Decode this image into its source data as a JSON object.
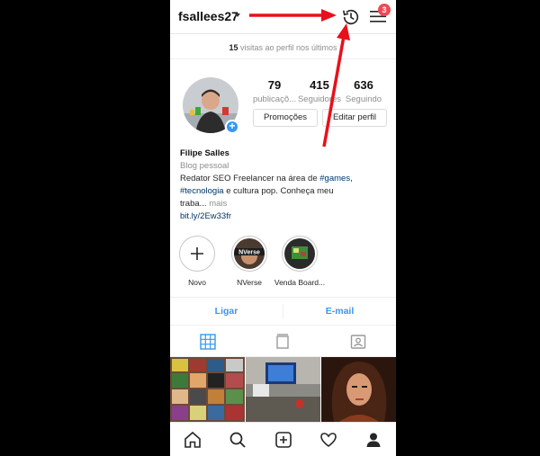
{
  "header": {
    "username": "fsallees27",
    "notif_count": "3"
  },
  "visits": {
    "count": "15",
    "text": " visitas ao perfil nos últimos"
  },
  "stats": [
    {
      "num": "79",
      "label": "publicaçõ..."
    },
    {
      "num": "415",
      "label": "Seguidores"
    },
    {
      "num": "636",
      "label": "Seguindo"
    }
  ],
  "buttons": {
    "promo": "Promoções",
    "edit": "Editar perfil"
  },
  "bio": {
    "name": "Filipe Salles",
    "category": "Blog pessoal",
    "line1": "Redator SEO Freelancer na área de ",
    "tag_games": "#games",
    "line1_end": ",",
    "tag_tec": "#tecnologia",
    "line2": " e cultura pop. Conheça meu",
    "line3": "traba...",
    "more": " mais",
    "link": "bit.ly/2Ew33fr"
  },
  "highlights": [
    {
      "label": "Novo"
    },
    {
      "label": "NVerse",
      "cover_text": "NVerse"
    },
    {
      "label": "Venda Board..."
    }
  ],
  "contact": {
    "call": "Ligar",
    "email": "E-mail"
  },
  "colors": {
    "accent": "#3897f0",
    "badge": "#ed4956",
    "arrow": "#e8101a"
  }
}
